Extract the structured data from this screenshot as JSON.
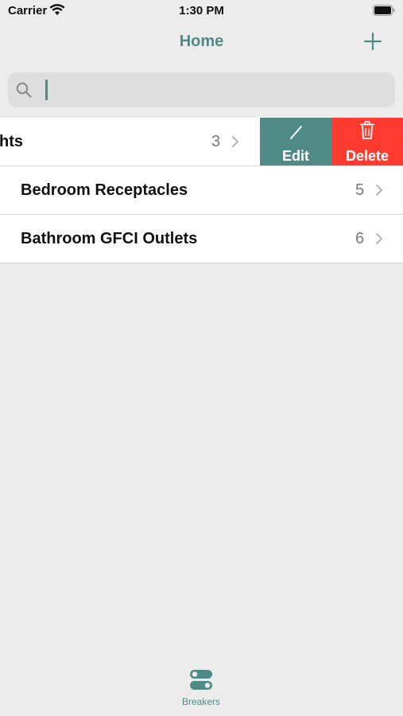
{
  "status_bar": {
    "carrier": "Carrier",
    "time": "1:30 PM",
    "wifi_icon": "wifi-icon",
    "battery_icon": "battery-icon"
  },
  "nav": {
    "title": "Home",
    "add_icon": "plus-icon"
  },
  "search": {
    "value": "",
    "placeholder": "",
    "icon": "search-icon"
  },
  "list": {
    "rows": [
      {
        "label": "hts",
        "count": "3",
        "swiped": true
      },
      {
        "label": "Bedroom Receptacles",
        "count": "5"
      },
      {
        "label": "Bathroom GFCI Outlets",
        "count": "6"
      }
    ],
    "swipe_actions": {
      "edit_label": "Edit",
      "delete_label": "Delete",
      "edit_color": "#4f8a87",
      "delete_color": "#ff3b30"
    }
  },
  "tab_bar": {
    "items": [
      {
        "label": "Breakers",
        "icon": "toggle-switches-icon",
        "selected": true
      }
    ]
  },
  "colors": {
    "accent": "#4f8a87",
    "background": "#ececec",
    "destructive": "#ff3b30"
  }
}
